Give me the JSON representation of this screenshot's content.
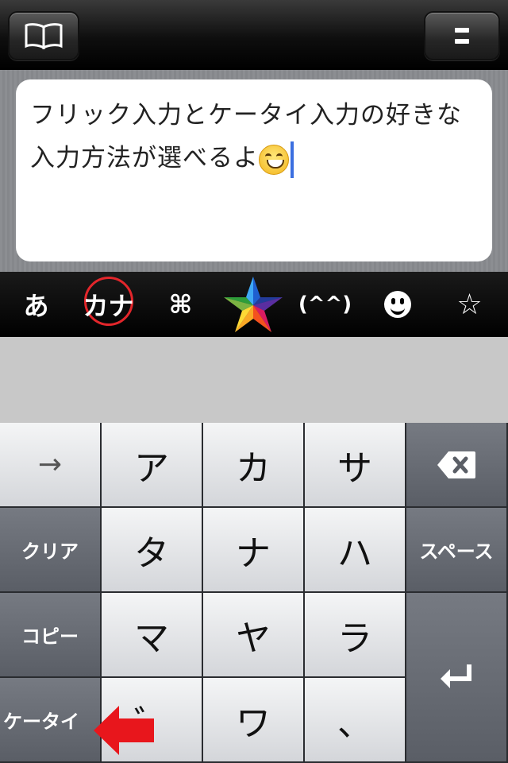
{
  "top_bar": {
    "left_icon": "book-icon",
    "right_icon": "menu-icon"
  },
  "editor": {
    "text": "フリック入力とケータイ入力の好きな入力方法が選べるよ",
    "emoji": "grinning-face-emoji"
  },
  "toolbar": {
    "items": [
      {
        "label": "あ",
        "name": "hiragana"
      },
      {
        "label": "カナ",
        "name": "katakana",
        "selected": true
      },
      {
        "label": "⌘",
        "name": "symbol"
      },
      {
        "label": "",
        "name": "star-app-icon"
      },
      {
        "label": "(^^)",
        "name": "kaomoji"
      },
      {
        "label": "",
        "name": "emoji-smiley-icon"
      },
      {
        "label": "☆",
        "name": "favorites"
      }
    ],
    "highlight_color": "#e3262b"
  },
  "keyboard": {
    "left_keys": [
      "→",
      "クリア",
      "コピー",
      "ケータイ"
    ],
    "grid": [
      [
        "ア",
        "カ",
        "サ"
      ],
      [
        "タ",
        "ナ",
        "ハ"
      ],
      [
        "マ",
        "ヤ",
        "ラ"
      ],
      [
        "゛",
        "ワ",
        "、"
      ]
    ],
    "right_keys": {
      "delete_icon": "backspace-icon",
      "space": "スペース",
      "enter_icon": "return-icon"
    }
  },
  "annotation": {
    "arrow_color": "#e8161c"
  }
}
